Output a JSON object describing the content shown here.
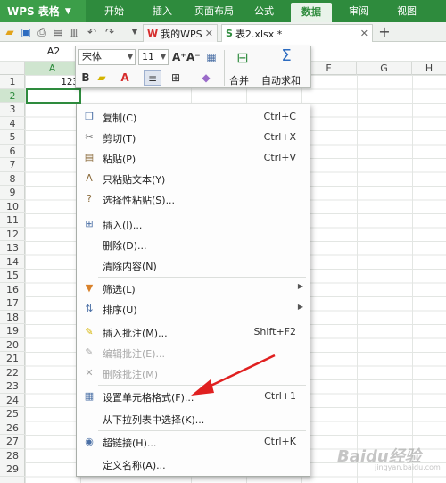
{
  "app": {
    "name": "WPS 表格"
  },
  "ribbon_tabs": [
    {
      "label": "开始",
      "active": false
    },
    {
      "label": "插入",
      "active": false
    },
    {
      "label": "页面布局",
      "active": false
    },
    {
      "label": "公式",
      "active": false
    },
    {
      "label": "数据",
      "active": true
    },
    {
      "label": "审阅",
      "active": false
    },
    {
      "label": "视图",
      "active": false
    }
  ],
  "doc_tabs": [
    {
      "label": "我的WPS",
      "close": "✕"
    },
    {
      "label": "表2.xlsx *",
      "close": "✕"
    }
  ],
  "new_tab_label": "+",
  "name_box": "A2",
  "columns": [
    "A",
    "B",
    "C",
    "D",
    "E",
    "F",
    "G",
    "H"
  ],
  "rows": [
    "1",
    "2",
    "3",
    "4",
    "5",
    "6",
    "7",
    "8",
    "9",
    "10",
    "11",
    "12",
    "13",
    "14",
    "15",
    "16",
    "17",
    "18",
    "19",
    "20",
    "21",
    "22",
    "23",
    "24",
    "25",
    "26",
    "27",
    "28",
    "29"
  ],
  "cell_a1_value": "123",
  "mini_toolbar": {
    "font_name": "宋体",
    "font_size": "11",
    "merge_label": "合并",
    "autosum_label": "自动求和"
  },
  "context_menu": [
    {
      "label": "复制(C)",
      "shortcut": "Ctrl+C",
      "icon": "copy-icon",
      "disabled": false
    },
    {
      "label": "剪切(T)",
      "shortcut": "Ctrl+X",
      "icon": "scissors-icon",
      "disabled": false
    },
    {
      "label": "粘贴(P)",
      "shortcut": "Ctrl+V",
      "icon": "paste-icon",
      "disabled": false
    },
    {
      "label": "只粘贴文本(Y)",
      "shortcut": "",
      "icon": "paste-text-icon",
      "disabled": false
    },
    {
      "label": "选择性粘贴(S)...",
      "shortcut": "",
      "icon": "paste-special-icon",
      "disabled": false
    },
    {
      "label": "插入(I)...",
      "shortcut": "",
      "icon": "insert-icon",
      "disabled": false
    },
    {
      "label": "删除(D)...",
      "shortcut": "",
      "icon": "",
      "disabled": false
    },
    {
      "label": "清除内容(N)",
      "shortcut": "",
      "icon": "",
      "disabled": false
    },
    {
      "label": "筛选(L)",
      "shortcut": "",
      "icon": "filter-icon",
      "disabled": false,
      "submenu": true
    },
    {
      "label": "排序(U)",
      "shortcut": "",
      "icon": "sort-icon",
      "disabled": false,
      "submenu": true
    },
    {
      "label": "插入批注(M)...",
      "shortcut": "Shift+F2",
      "icon": "comment-insert-icon",
      "disabled": false
    },
    {
      "label": "编辑批注(E)...",
      "shortcut": "",
      "icon": "comment-edit-icon",
      "disabled": true
    },
    {
      "label": "删除批注(M)",
      "shortcut": "",
      "icon": "comment-delete-icon",
      "disabled": true
    },
    {
      "label": "设置单元格格式(F)...",
      "shortcut": "Ctrl+1",
      "icon": "format-cells-icon",
      "disabled": false
    },
    {
      "label": "从下拉列表中选择(K)...",
      "shortcut": "",
      "icon": "",
      "disabled": false
    },
    {
      "label": "超链接(H)...",
      "shortcut": "Ctrl+K",
      "icon": "hyperlink-icon",
      "disabled": false
    },
    {
      "label": "定义名称(A)...",
      "shortcut": "",
      "icon": "",
      "disabled": false
    }
  ],
  "colors": {
    "brand_green": "#2e8b3d",
    "arrow_red": "#e02020"
  },
  "watermark": {
    "main": "Baidu经验",
    "sub": "jingyan.baidu.com"
  }
}
